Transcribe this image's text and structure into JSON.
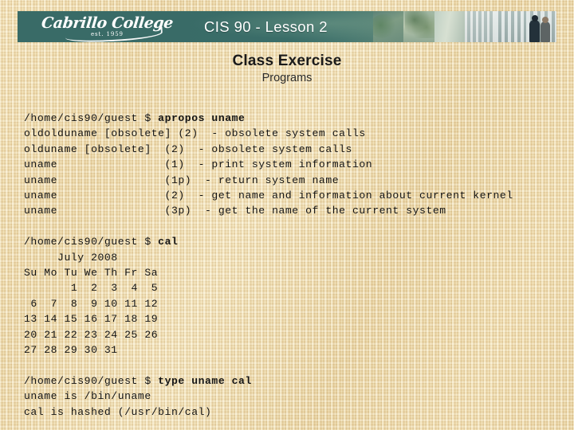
{
  "header": {
    "logo_script": "Cabrillo College",
    "logo_est": "est. 1959",
    "title": "CIS 90 - Lesson 2",
    "teal": "#396b67"
  },
  "slide": {
    "title": "Class Exercise",
    "subtitle": "Programs",
    "background": "#e9d6a6"
  },
  "terminal": {
    "prompt": "/home/cis90/guest $ ",
    "blocks": [
      {
        "command": "apropos uname",
        "output": [
          "oldolduname [obsolete] (2)  - obsolete system calls",
          "olduname [obsolete]  (2)  - obsolete system calls",
          "uname                (1)  - print system information",
          "uname                (1p)  - return system name",
          "uname                (2)  - get name and information about current kernel",
          "uname                (3p)  - get the name of the current system"
        ]
      },
      {
        "command": "cal",
        "output": [
          "     July 2008",
          "Su Mo Tu We Th Fr Sa",
          "       1  2  3  4  5",
          " 6  7  8  9 10 11 12",
          "13 14 15 16 17 18 19",
          "20 21 22 23 24 25 26",
          "27 28 29 30 31"
        ]
      },
      {
        "command": "type uname cal",
        "output": [
          "uname is /bin/uname",
          "cal is hashed (/usr/bin/cal)"
        ]
      }
    ]
  }
}
